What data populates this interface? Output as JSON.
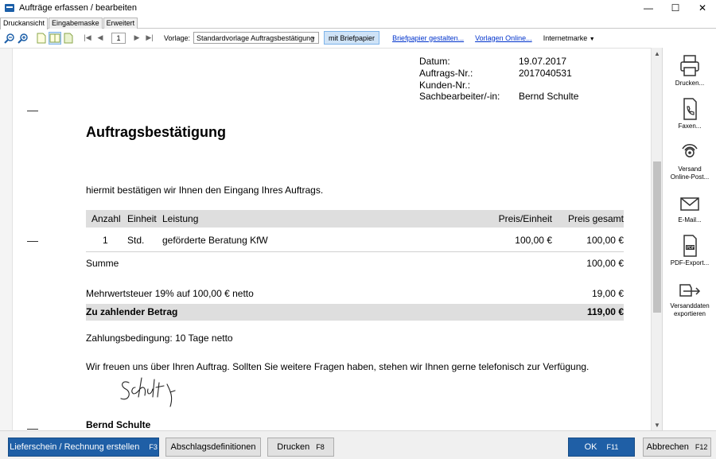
{
  "window": {
    "title": "Aufträge erfassen / bearbeiten",
    "controls": {
      "minimize": "—",
      "maximize": "☐",
      "close": "✕"
    }
  },
  "tabs": [
    {
      "label": "Druckansicht",
      "active": true
    },
    {
      "label": "Eingabemaske",
      "active": false
    },
    {
      "label": "Erweitert",
      "active": false
    }
  ],
  "toolbar": {
    "page_number": "1",
    "template_label": "Vorlage:",
    "template_value": "Standardvorlage Auftragsbestätigung",
    "letterhead_toggle": "mit Briefpapier",
    "design_letterhead_link": "Briefpapier gestalten...",
    "online_templates_link": "Vorlagen Online...",
    "stamp_menu": "Internetmarke"
  },
  "document": {
    "meta": [
      {
        "label": "Datum:",
        "value": "19.07.2017"
      },
      {
        "label": "Auftrags-Nr.:",
        "value": "2017040531"
      },
      {
        "label": "Kunden-Nr.:",
        "value": ""
      },
      {
        "label": "Sachbearbeiter/-in:",
        "value": "Bernd Schulte"
      }
    ],
    "title": "Auftragsbestätigung",
    "intro": "hiermit bestätigen wir Ihnen den Eingang Ihres Auftrags.",
    "table": {
      "headers": {
        "qty": "Anzahl",
        "unit": "Einheit",
        "service": "Leistung",
        "unit_price": "Preis/Einheit",
        "total_price": "Preis gesamt"
      },
      "rows": [
        {
          "qty": "1",
          "unit": "Std.",
          "service": "geförderte Beratung KfW",
          "unit_price": "100,00 €",
          "total_price": "100,00 €"
        }
      ]
    },
    "sum": {
      "label": "Summe",
      "value": "100,00 €"
    },
    "vat": {
      "label": "Mehrwertsteuer 19% auf 100,00 € netto",
      "value": "19,00 €"
    },
    "total": {
      "label": "Zu zahlender Betrag",
      "value": "119,00 €"
    },
    "payment_terms": "Zahlungsbedingung: 10 Tage netto",
    "closing": "Wir freuen uns über Ihren Auftrag.  Sollten Sie weitere Fragen haben, stehen wir Ihnen gerne telefonisch zur Verfügung.",
    "signer": "Bernd Schulte"
  },
  "sidepanel": {
    "print": "Drucken...",
    "fax": "Faxen...",
    "online_post_1": "Versand",
    "online_post_2": "Online-Post...",
    "email": "E-Mail...",
    "pdf": "PDF-Export...",
    "export_1": "Versanddaten",
    "export_2": "exportieren"
  },
  "bottom": {
    "create_invoice": "Lieferschein / Rechnung erstellen",
    "create_invoice_key": "F3",
    "installments": "Abschlagsdefinitionen",
    "print": "Drucken",
    "print_key": "F8",
    "ok": "OK",
    "ok_key": "F11",
    "cancel": "Abbrechen",
    "cancel_key": "F12"
  },
  "colors": {
    "primary_button": "#1f5fa6",
    "table_header_bg": "#dedede",
    "link": "#0033cc",
    "toggle_active": "#cfe3f7"
  }
}
